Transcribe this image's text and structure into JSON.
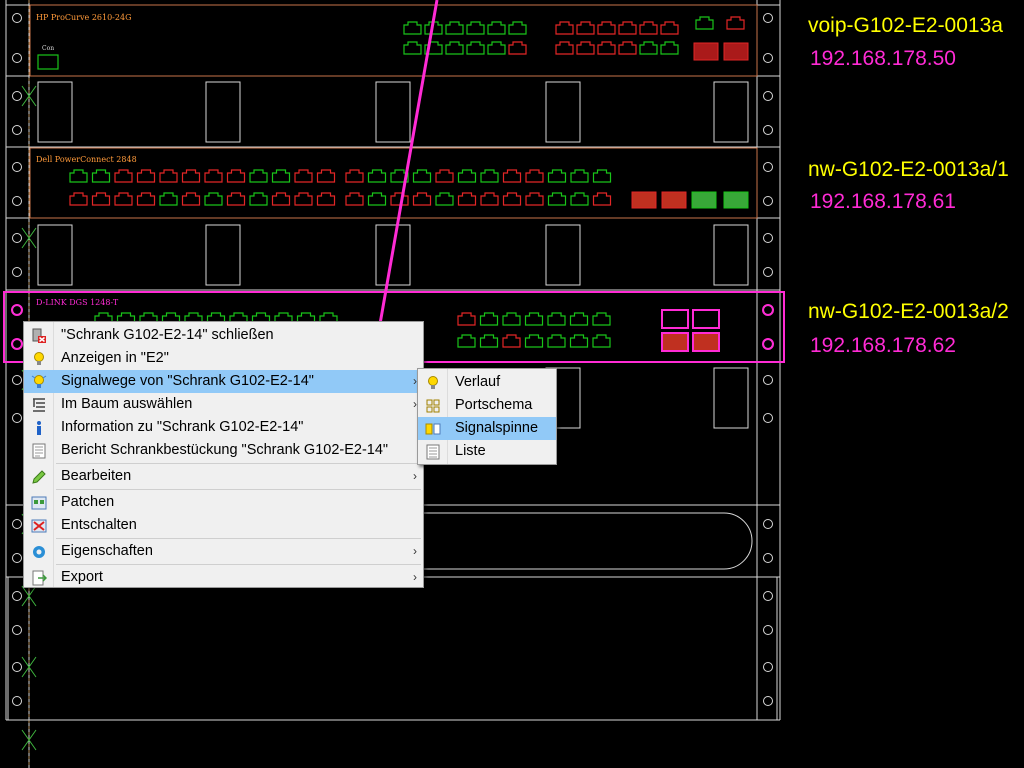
{
  "devices": {
    "dev1_title": "HP ProCurve 2610-24G",
    "dev2_title": "Dell PowerConnect 2848",
    "dev3_title": "D-LINK DGS 1248-T",
    "console_label": "Con"
  },
  "right_labels": [
    {
      "name": "voip-G102-E2-0013a",
      "ip": "192.168.178.50"
    },
    {
      "name": "nw-G102-E2-0013a/1",
      "ip": "192.168.178.61"
    },
    {
      "name": "nw-G102-E2-0013a/2",
      "ip": "192.168.178.62"
    }
  ],
  "context_menu": {
    "items": [
      {
        "label": "\"Schrank G102-E2-14\" schließen",
        "icon": "close-rack-icon"
      },
      {
        "label": "Anzeigen in \"E2\"",
        "icon": "lightbulb-icon"
      },
      {
        "label": "Signalwege von \"Schrank G102-E2-14\"",
        "icon": "signal-path-icon",
        "submenu": true,
        "highlighted": true
      },
      {
        "label": "Im Baum auswählen",
        "icon": "tree-icon",
        "submenu": true
      },
      {
        "label": "Information zu \"Schrank G102-E2-14\"",
        "icon": "info-icon"
      },
      {
        "label": "Bericht Schrankbestückung \"Schrank G102-E2-14\"",
        "icon": "report-icon"
      },
      {
        "label": "Bearbeiten",
        "icon": "pencil-icon",
        "submenu": true
      },
      {
        "label": "Patchen",
        "icon": "patch-icon"
      },
      {
        "label": "Entschalten",
        "icon": "unpatch-icon"
      },
      {
        "label": "Eigenschaften",
        "icon": "gear-icon",
        "submenu": true
      },
      {
        "label": "Export",
        "icon": "export-icon",
        "submenu": true
      }
    ]
  },
  "submenu": {
    "items": [
      {
        "label": "Verlauf",
        "icon": "lightbulb-icon"
      },
      {
        "label": "Portschema",
        "icon": "port-schema-icon"
      },
      {
        "label": "Signalspinne",
        "icon": "signal-spider-icon",
        "highlighted": true
      },
      {
        "label": "Liste",
        "icon": "list-icon"
      }
    ]
  },
  "colors": {
    "port_green": "#19c419",
    "port_red": "#e22626",
    "highlight_magenta": "#ff2bd5",
    "menu_highlight": "#91c9f7",
    "label_yellow": "#ffff00"
  }
}
